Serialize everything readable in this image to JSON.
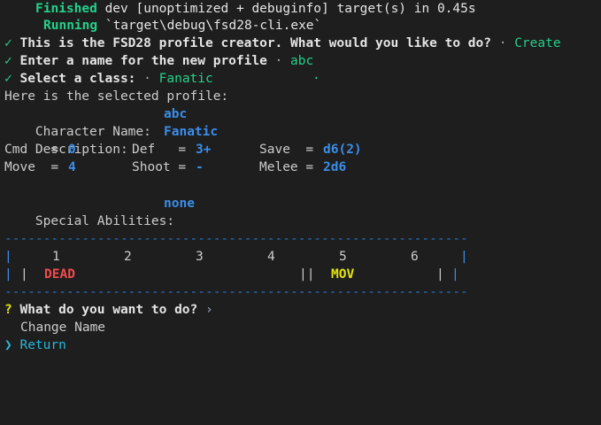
{
  "build": {
    "finished_word": "Finished",
    "finished_text": " dev [unoptimized + debuginfo] target(s) in 0.45s",
    "running_word": "Running",
    "running_text": " `target\\debug\\fsd28-cli.exe`"
  },
  "prompts": [
    {
      "check": "✓",
      "question": "This is the FSD28 profile creator. What would you like to do?",
      "sep": " · ",
      "answer": "Create"
    },
    {
      "check": "✓",
      "question": "Enter a name for the new profile",
      "sep": " · ",
      "answer": "abc"
    },
    {
      "check": "✓",
      "question": "Select a class:",
      "sep": " · ",
      "answer": "Fanatic",
      "trail": "·"
    }
  ],
  "profile": {
    "header": "Here is the selected profile:",
    "name_label": "Character Name:",
    "name_value": "abc",
    "desc_label": "Description:",
    "desc_value": "Fanatic",
    "stats": {
      "cmd_label": "Cmd   =",
      "cmd_value": "0",
      "def_label": "Def   =",
      "def_value": "3+",
      "save_label": "Save  =",
      "save_value": "d6(2)",
      "move_label": "Move  =",
      "move_value": "4",
      "shoot_label": "Shoot =",
      "shoot_value": "-",
      "melee_label": "Melee =",
      "melee_value": "2d6"
    },
    "abilities_label": "Special Abilities:",
    "abilities_value": "none"
  },
  "track": {
    "separator": "----------------------------------------------------------------",
    "numbers": [
      "1",
      "2",
      "3",
      "4",
      "5",
      "6"
    ],
    "pipe": "|",
    "double_pipe": "||",
    "dead_label": "DEAD",
    "mov_label": "MOV"
  },
  "menu": {
    "qmark": "?",
    "question": "What do you want to do?",
    "caret": "›",
    "items": [
      {
        "label": "Change Name",
        "selected": false
      },
      {
        "label": "Return",
        "selected": true
      }
    ],
    "pointer": "❯"
  },
  "colors": {
    "background": "#1e1e1e",
    "green": "#23d18b",
    "blue": "#3b8eea",
    "red": "#f14c4c",
    "yellow": "#e5e510"
  }
}
